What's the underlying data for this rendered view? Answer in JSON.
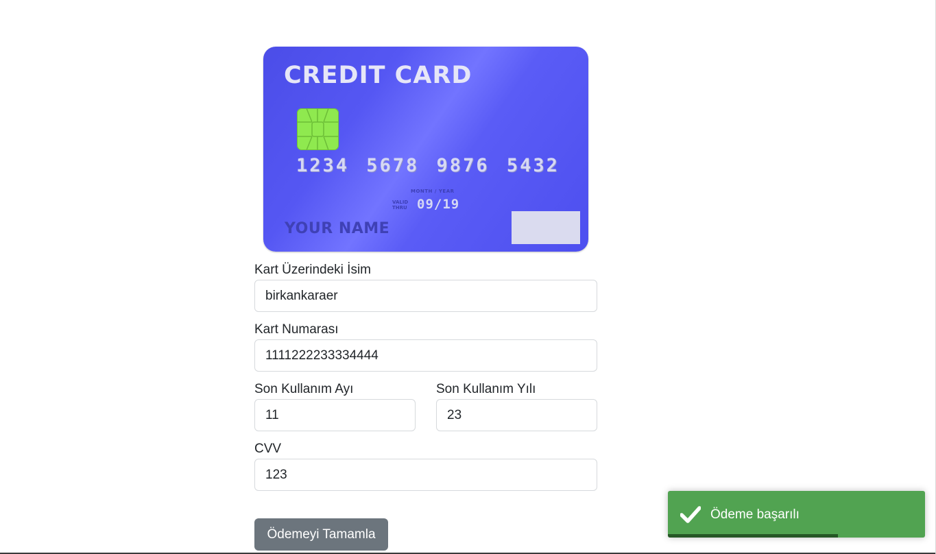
{
  "card": {
    "title": "CREDIT CARD",
    "number": "1234 5678 9876 5432",
    "month_year_label": "MONTH / YEAR",
    "valid_thru_line1": "VALID",
    "valid_thru_line2": "THRU",
    "expiry": "09/19",
    "holder": "YOUR NAME"
  },
  "form": {
    "name_label": "Kart Üzerindeki İsim",
    "name_value": "birkankaraer",
    "number_label": "Kart Numarası",
    "number_value": "1111222233334444",
    "exp_month_label": "Son Kullanım Ayı",
    "exp_month_value": "11",
    "exp_year_label": "Son Kullanım Yılı",
    "exp_year_value": "23",
    "cvv_label": "CVV",
    "cvv_value": "123",
    "submit_label": "Ödemeyi Tamamla"
  },
  "toast": {
    "icon": "check-icon",
    "message": "Ödeme başarılı",
    "progress": 0.66,
    "color": "#51a351"
  },
  "colors": {
    "card_accent": "#5557f3",
    "chip": "#8fe94f",
    "button": "#6c757d"
  }
}
